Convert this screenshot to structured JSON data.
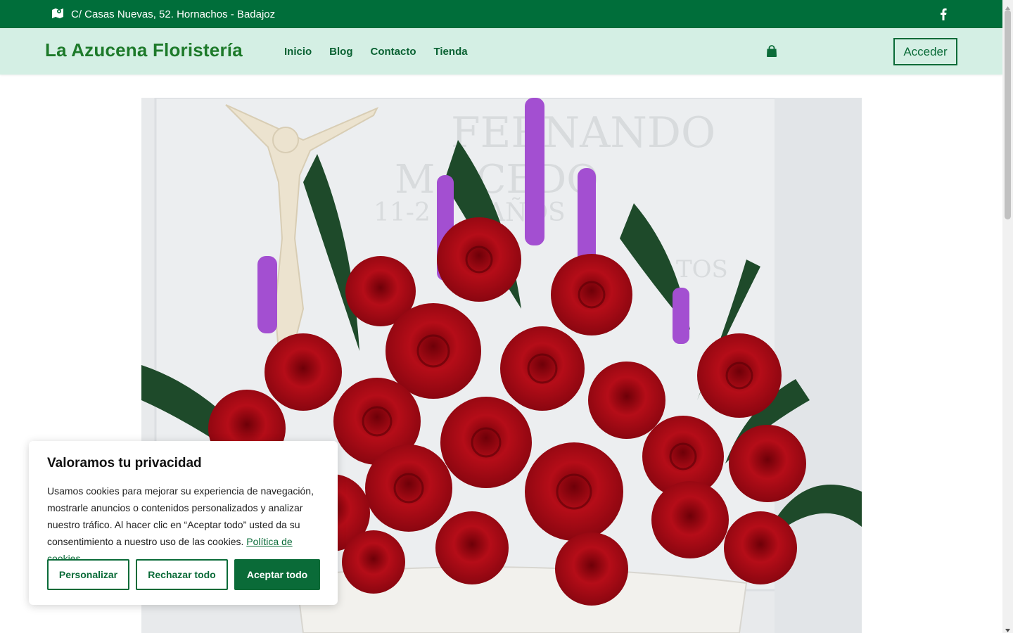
{
  "topbar": {
    "address": "C/ Casas Nuevas, 52. Hornachos - Badajoz",
    "address_icon": "map-icon",
    "social_icon": "facebook-icon"
  },
  "header": {
    "logo": "La Azucena Floristería",
    "nav": [
      "Inicio",
      "Blog",
      "Contacto",
      "Tienda"
    ],
    "cart_icon": "shopping-bag-icon",
    "login": "Acceder"
  },
  "hero": {
    "image": "red roses and purple liatris arrangement in front of white marble plaque"
  },
  "cookie": {
    "title": "Valoramos tu privacidad",
    "text": "Usamos cookies para mejorar su experiencia de navegación, mostrarle anuncios o contenidos personalizados y analizar nuestro tráfico. Al hacer clic en “Aceptar todo” usted da su consentimiento a nuestro uso de las cookies.",
    "policy_link": "Política de cookies",
    "btn_customize": "Personalizar",
    "btn_reject": "Rechazar todo",
    "btn_accept": "Aceptar todo"
  },
  "colors": {
    "brand_green": "#006e3a",
    "header_bg": "#d4efe4",
    "logo_green": "#1d7a2a"
  }
}
